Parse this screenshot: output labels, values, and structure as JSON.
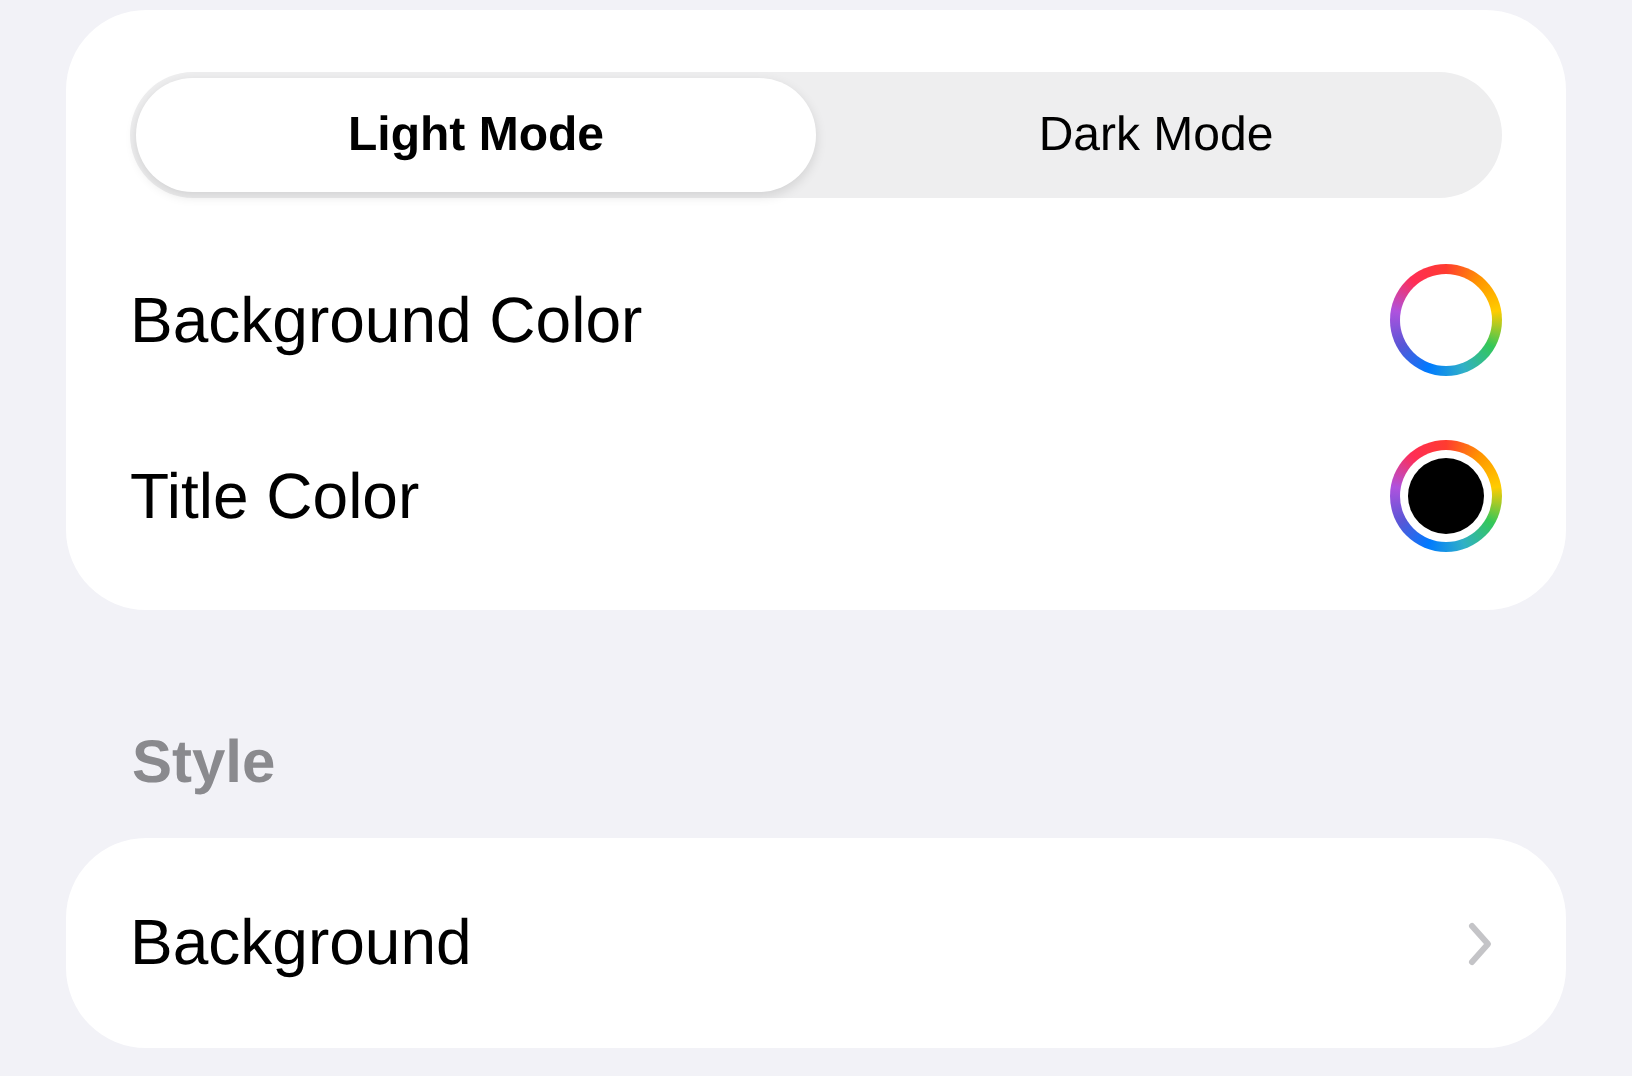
{
  "segmented_control": [
    {
      "label": "Light Mode",
      "selected": true
    },
    {
      "label": "Dark Mode",
      "selected": false
    }
  ],
  "color_rows": [
    {
      "label": "Background Color",
      "color": "#ffffff"
    },
    {
      "label": "Title Color",
      "color": "#000000"
    }
  ],
  "sections": [
    {
      "header": "Style",
      "rows": [
        {
          "label": "Background",
          "kind": "disclosure"
        }
      ]
    }
  ]
}
